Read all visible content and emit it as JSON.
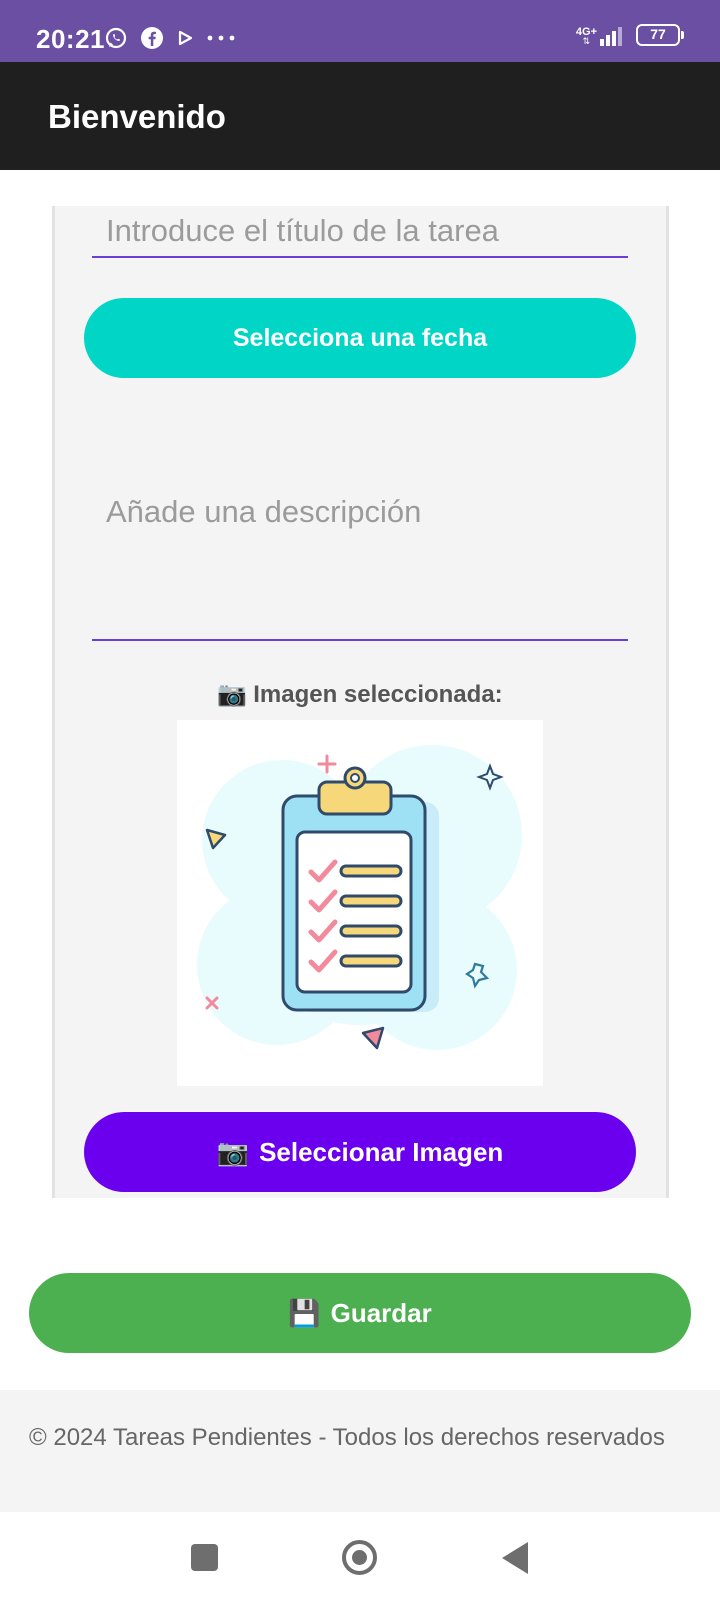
{
  "status_bar": {
    "time": "20:21",
    "left_icons": [
      "whatsapp-icon",
      "facebook-icon",
      "play-icon",
      "more-icon"
    ],
    "network": "4G+",
    "battery": "77"
  },
  "app_bar": {
    "title": "Bienvenido"
  },
  "form": {
    "title_placeholder": "Introduce el título de la tarea",
    "date_button": "Selecciona una fecha",
    "description_placeholder": "Añade una descripción",
    "image_label": "Imagen seleccionada:",
    "image_label_icon": "📷",
    "pick_image_icon": "📷",
    "pick_image_button": "Seleccionar Imagen"
  },
  "actions": {
    "save_icon": "💾",
    "save_button": "Guardar"
  },
  "footer": {
    "text": "© 2024 Tareas Pendientes - Todos los derechos reservados"
  },
  "colors": {
    "status_bar": "#6a4fa3",
    "app_bar": "#1f1f1f",
    "date_button": "#00d5c6",
    "pick_button": "#6a00ee",
    "save_button": "#4caf50",
    "underline": "#6a3fd3"
  }
}
